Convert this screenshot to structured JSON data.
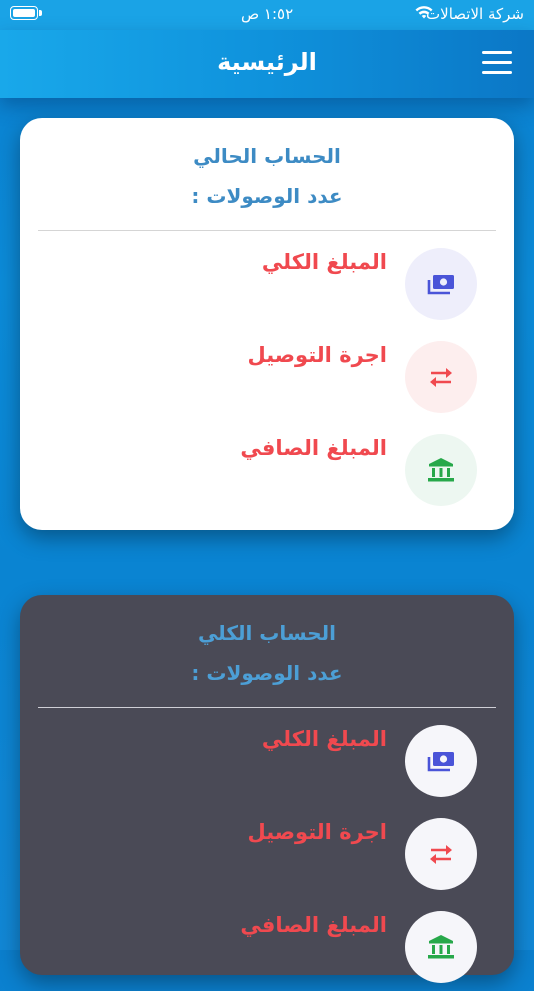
{
  "status_bar": {
    "carrier": "شركة الاتصالات",
    "time": "١:٥٢ ص",
    "wifi_icon": "wifi-icon",
    "battery_icon": "battery-icon"
  },
  "header": {
    "title": "الرئيسية",
    "menu_icon": "hamburger-menu-icon"
  },
  "cards": [
    {
      "title": "الحساب الحالي",
      "count_label": "عدد الوصولات :",
      "rows": [
        {
          "label": "المبلغ الكلي",
          "icon": "money-icon",
          "icon_color": "#4a54d8",
          "bg": "#eeeefb"
        },
        {
          "label": "اجرة التوصيل",
          "icon": "exchange-arrows-icon",
          "icon_color": "#f0494f",
          "bg": "#fdeeee"
        },
        {
          "label": "المبلغ الصافي",
          "icon": "bank-icon",
          "icon_color": "#27a84a",
          "bg": "#edf7f1"
        }
      ]
    },
    {
      "title": "الحساب الكلي",
      "count_label": "عدد الوصولات :",
      "rows": [
        {
          "label": "المبلغ الكلي",
          "icon": "money-icon",
          "icon_color": "#4a54d8"
        },
        {
          "label": "اجرة التوصيل",
          "icon": "exchange-arrows-icon",
          "icon_color": "#f0494f"
        },
        {
          "label": "المبلغ الصافي",
          "icon": "bank-icon",
          "icon_color": "#27a84a"
        }
      ]
    }
  ],
  "colors": {
    "accent": "#3d8bc4",
    "label_red": "#f0494f",
    "dark_card": "#4a4a56",
    "header_blue": "#19a8ea"
  }
}
